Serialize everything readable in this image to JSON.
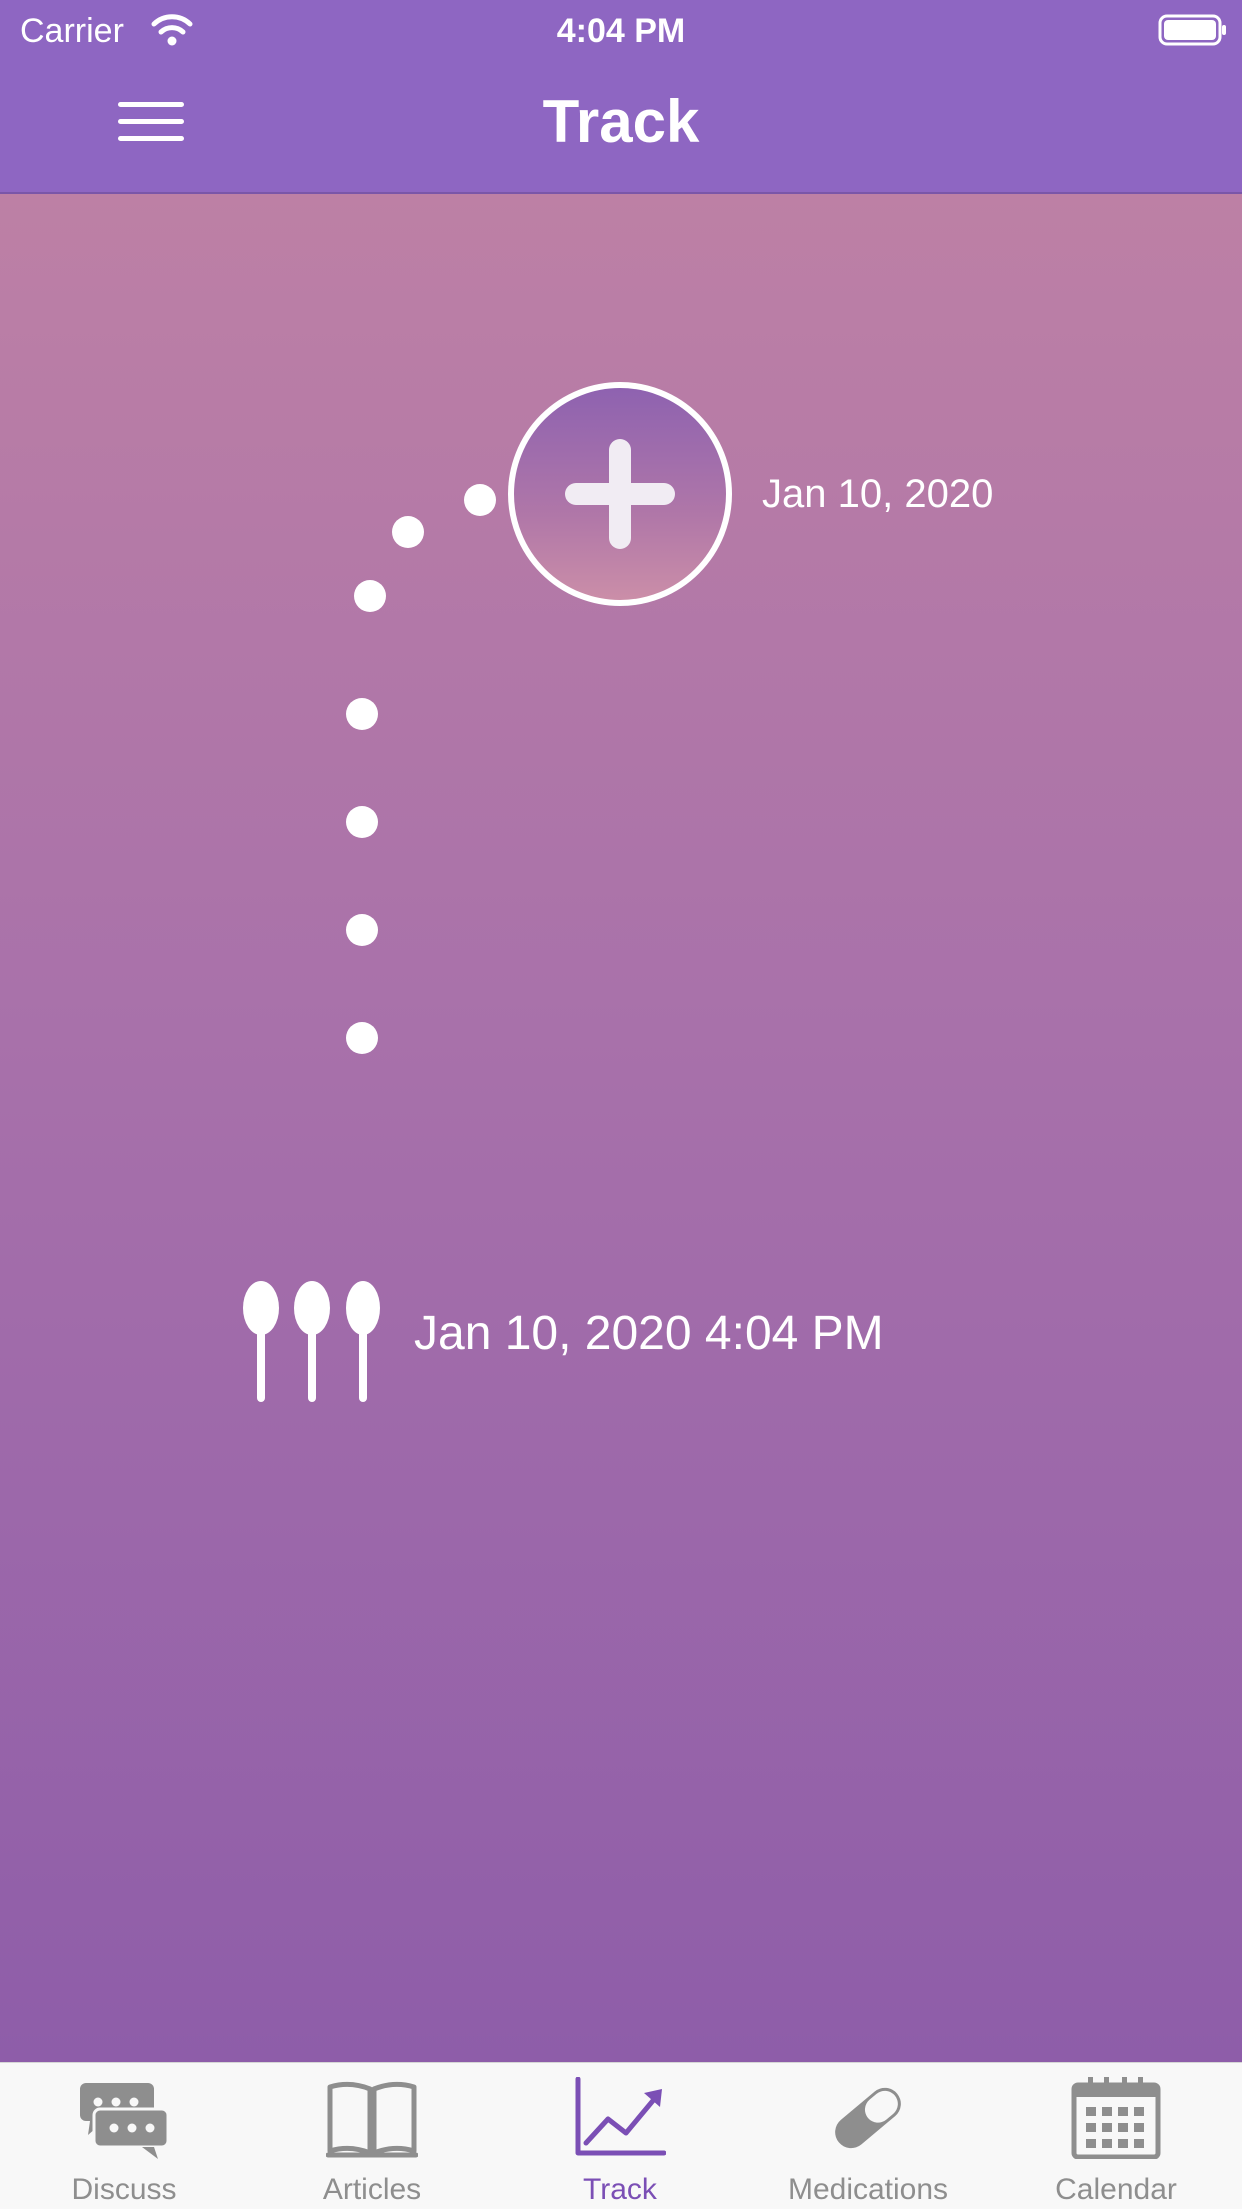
{
  "status_bar": {
    "carrier": "Carrier",
    "time": "4:04 PM"
  },
  "header": {
    "title": "Track"
  },
  "tracker": {
    "add_date": "Jan 10, 2020",
    "entry_time": "Jan 10, 2020 4:04 PM"
  },
  "tabs": [
    {
      "label": "Discuss",
      "icon": "chat-bubbles-icon",
      "active": false
    },
    {
      "label": "Articles",
      "icon": "open-book-icon",
      "active": false
    },
    {
      "label": "Track",
      "icon": "trend-chart-icon",
      "active": true
    },
    {
      "label": "Medications",
      "icon": "pill-icon",
      "active": false
    },
    {
      "label": "Calendar",
      "icon": "calendar-icon",
      "active": false
    }
  ],
  "colors": {
    "header": "#8e66c2",
    "gradient_top": "#bd80a5",
    "gradient_bottom": "#8e5da9",
    "tab_active": "#7b4fb5",
    "tab_inactive": "#8e8e8e"
  }
}
